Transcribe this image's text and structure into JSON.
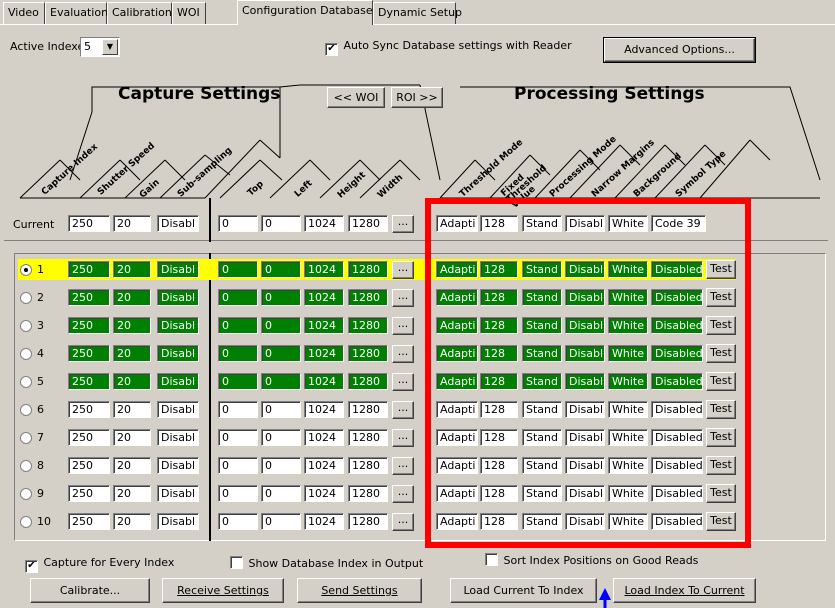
{
  "tabs": [
    {
      "label": "Video"
    },
    {
      "label": "Evaluation"
    },
    {
      "label": "Calibration"
    },
    {
      "label": "WOI"
    },
    {
      "label": "Configuration Database"
    },
    {
      "label": "Dynamic Setup"
    }
  ],
  "active_indexes": {
    "label": "Active Indexes",
    "value": "5"
  },
  "auto_sync": {
    "label": "Auto Sync Database settings with Reader",
    "checked": true
  },
  "advanced_button": "Advanced Options...",
  "capture_title": "Capture Settings",
  "processing_title": "Processing Settings",
  "woi_button": "<< WOI",
  "roi_button": "ROI >>",
  "capture_columns": [
    "Capture Index",
    "Shutter Speed",
    "Gain",
    "Sub-sampling"
  ],
  "woi_columns": [
    "Top",
    "Left",
    "Height",
    "Width"
  ],
  "processing_columns": [
    "Threshold Mode",
    "Fixed Threshold Value",
    "Processing Mode",
    "Narrow Margins",
    "Background",
    "Symbol Type"
  ],
  "current": {
    "label": "Current",
    "shutter": "250",
    "gain": "20",
    "sub": "Disabl",
    "top": "0",
    "left": "0",
    "height": "1024",
    "width": "1280",
    "ellipsis": "...",
    "threshold": "Adapti",
    "fixed": "128",
    "proc": "Stand",
    "narrow": "Disabl",
    "bg": "White",
    "symbol": "Code 39"
  },
  "rows": [
    {
      "index": "1",
      "selected": true,
      "active": true
    },
    {
      "index": "2",
      "selected": false,
      "active": true
    },
    {
      "index": "3",
      "selected": false,
      "active": true
    },
    {
      "index": "4",
      "selected": false,
      "active": true
    },
    {
      "index": "5",
      "selected": false,
      "active": true
    },
    {
      "index": "6",
      "selected": false,
      "active": false
    },
    {
      "index": "7",
      "selected": false,
      "active": false
    },
    {
      "index": "8",
      "selected": false,
      "active": false
    },
    {
      "index": "9",
      "selected": false,
      "active": false
    },
    {
      "index": "10",
      "selected": false,
      "active": false
    }
  ],
  "row_values": {
    "shutter": "250",
    "gain": "20",
    "sub": "Disabl",
    "top": "0",
    "left": "0",
    "height": "1024",
    "width": "1280",
    "ellipsis": "...",
    "threshold": "Adapti",
    "fixed": "128",
    "proc": "Stand",
    "narrow": "Disabl",
    "bg": "White",
    "symbol": "Disabled",
    "test": "Test"
  },
  "checkboxes": {
    "capture_every": {
      "label": "Capture for Every Index",
      "checked": true
    },
    "show_index": {
      "label": "Show Database Index in Output",
      "checked": false
    },
    "sort_index": {
      "label": "Sort Index Positions on Good Reads",
      "checked": false
    }
  },
  "buttons": {
    "calibrate": "Calibrate...",
    "receive": "Receive Settings",
    "send": "Send Settings",
    "load_current": "Load Current To Index",
    "load_index": "Load Index To Current"
  },
  "colors": {
    "active_field": "#008000",
    "selected_row": "#ffff00",
    "highlight_box": "#ff0000",
    "arrow": "#0000ff"
  }
}
